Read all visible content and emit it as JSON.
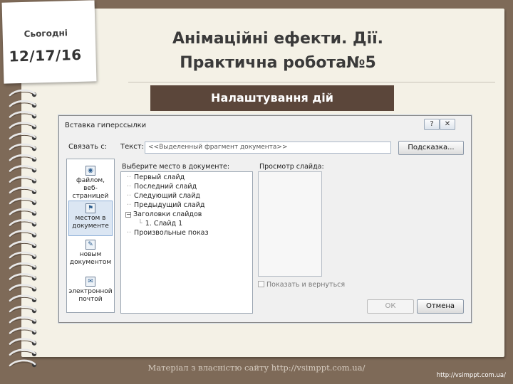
{
  "note": {
    "label": "Сьогодні",
    "date": "12/17/16"
  },
  "title": {
    "line1": "Анімаційні ефекти. Дії.",
    "line2": "Практична робота№5"
  },
  "subheading": "Налаштування дій",
  "dialog": {
    "title": "Вставка гиперссылки",
    "help_glyph": "?",
    "close_glyph": "✕",
    "link_label": "Связать с:",
    "text_label": "Текст:",
    "text_value": "<<Выделенный фрагмент документа>>",
    "hint_button": "Подсказка...",
    "left_items": [
      {
        "label": "файлом, веб-страницей",
        "icon": "globe-icon",
        "glyph": "◉"
      },
      {
        "label": "местом в документе",
        "icon": "document-place-icon",
        "glyph": "⚑"
      },
      {
        "label": "новым документом",
        "icon": "new-document-icon",
        "glyph": "✎"
      },
      {
        "label": "электронной почтой",
        "icon": "email-icon",
        "glyph": "✉"
      }
    ],
    "doc_place_label": "Выберите место в документе:",
    "tree": [
      {
        "label": "Первый слайд",
        "indent": 0,
        "marker": "dot"
      },
      {
        "label": "Последний слайд",
        "indent": 0,
        "marker": "dot"
      },
      {
        "label": "Следующий слайд",
        "indent": 0,
        "marker": "dot"
      },
      {
        "label": "Предыдущий слайд",
        "indent": 0,
        "marker": "dot"
      },
      {
        "label": "Заголовки слайдов",
        "indent": 0,
        "marker": "box",
        "box_glyph": "−"
      },
      {
        "label": "1. Слайд 1",
        "indent": 1,
        "marker": "dot"
      },
      {
        "label": "Произвольные показ",
        "indent": 0,
        "marker": "dot"
      }
    ],
    "preview_label": "Просмотр слайда:",
    "show_return": "Показать и вернуться",
    "ok": "ОК",
    "cancel": "Отмена"
  },
  "footer": "Матеріал з власністю сайту http://vsimppt.com.ua/",
  "url": "http://vsimppt.com.ua/",
  "colors": {
    "background": "#7e6a58",
    "paper": "#f4f1e6",
    "subheading_bg": "#5b463a"
  }
}
